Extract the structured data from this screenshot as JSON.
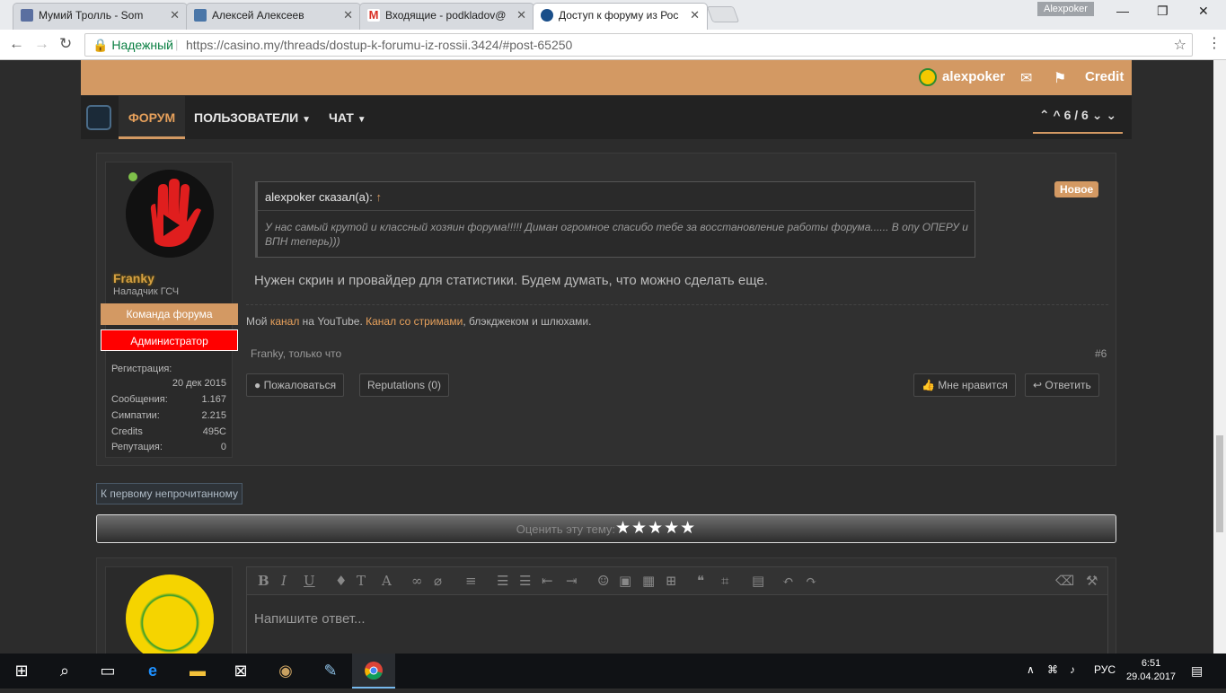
{
  "browser": {
    "tabs": [
      {
        "title": "Мумий Тролль - Som",
        "icon": "youtube-play-icon"
      },
      {
        "title": "Алексей Алексеев",
        "icon": "vk-icon"
      },
      {
        "title": "Входящие - podkladov@",
        "icon": "gmail-icon"
      },
      {
        "title": "Доступ к форуму из Рос",
        "icon": "forum-favicon"
      }
    ],
    "profile": "Alexpoker",
    "secure_label": "Надежный",
    "url": "https://casino.my/threads/dostup-k-forumu-iz-rossii.3424/#post-65250"
  },
  "site": {
    "username": "alexpoker",
    "credit_label": "Credit",
    "nav": {
      "forum": "ФОРУМ",
      "users": "ПОЛЬЗОВАТЕЛИ",
      "chat": "ЧАТ"
    },
    "pager": "6 / 6"
  },
  "post": {
    "author": "Franky",
    "author_title": "Наладчик ГСЧ",
    "banners": [
      "Команда форума",
      "Администратор"
    ],
    "stats": [
      {
        "label": "Регистрация:",
        "value": "20 дек 2015"
      },
      {
        "label": "Сообщения:",
        "value": "1.167"
      },
      {
        "label": "Симпатии:",
        "value": "2.215"
      },
      {
        "label": "Credits",
        "value": "495C"
      },
      {
        "label": "Репутация:",
        "value": "0"
      }
    ],
    "quote_author": "alexpoker сказал(а):",
    "quote_text": "У нас самый крутой и классный хозяин форума!!!!! Диман огромное спасибо тебе за восстановление работы форума...... В опу ОПЕРУ и ВПН теперь)))",
    "badge": "Новое",
    "message": "Нужен скрин и провайдер для статистики. Будем думать, что можно сделать еще.",
    "signature": {
      "p1": "Мой ",
      "l1": "канал",
      "p2": " на YouTube. ",
      "l2": "Канал со стримами",
      "p3": ", блэкджеком и шлюхами."
    },
    "meta": "Franky, только что",
    "number": "#6",
    "buttons": {
      "report": "Пожаловаться",
      "reputations": "Reputations (0)",
      "like": "Мне нравится",
      "reply": "Ответить"
    }
  },
  "first_unread": "К первому непрочитанному",
  "rating": {
    "label": "Оценить эту тему:",
    "stars": "★★★★★"
  },
  "editor": {
    "placeholder": "Напишите ответ..."
  },
  "taskbar": {
    "lang": "РУС",
    "time": "6:51",
    "date": "29.04.2017"
  }
}
